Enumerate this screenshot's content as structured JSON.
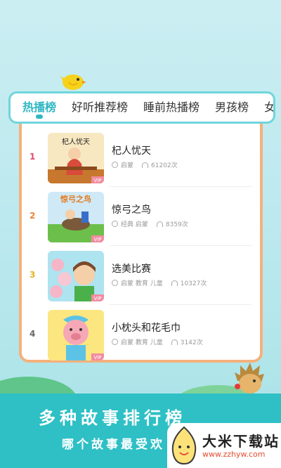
{
  "tabs": [
    {
      "label": "热播榜",
      "active": true
    },
    {
      "label": "好听推荐榜",
      "active": false
    },
    {
      "label": "睡前热播榜",
      "active": false
    },
    {
      "label": "男孩榜",
      "active": false
    },
    {
      "label": "女",
      "active": false
    }
  ],
  "list": [
    {
      "rank": "1",
      "rank_color": "#e14a6a",
      "title": "杞人忧天",
      "tags": "启蒙",
      "plays": "61202次",
      "thumb_text": "杞人忧天"
    },
    {
      "rank": "2",
      "rank_color": "#e8853a",
      "title": "惊弓之鸟",
      "tags": "经典 启蒙",
      "plays": "8359次",
      "thumb_text": "惊弓之鸟"
    },
    {
      "rank": "3",
      "rank_color": "#e6b21e",
      "title": "选美比赛",
      "tags": "启蒙 教育 儿童",
      "plays": "10327次",
      "thumb_text": ""
    },
    {
      "rank": "4",
      "rank_color": "#666666",
      "title": "小枕头和花毛巾",
      "tags": "启蒙 教育 儿童",
      "plays": "3142次",
      "thumb_text": ""
    }
  ],
  "vip_label": "VIP",
  "banner": {
    "title": "多种故事排行榜",
    "subtitle": "哪个故事最受欢"
  },
  "watermark": {
    "name": "大米下载站",
    "url": "www.zzhyw.com"
  },
  "colors": {
    "accent": "#2fb7c2",
    "card_border": "#f4b17c",
    "banner": "#2ec0c5"
  }
}
